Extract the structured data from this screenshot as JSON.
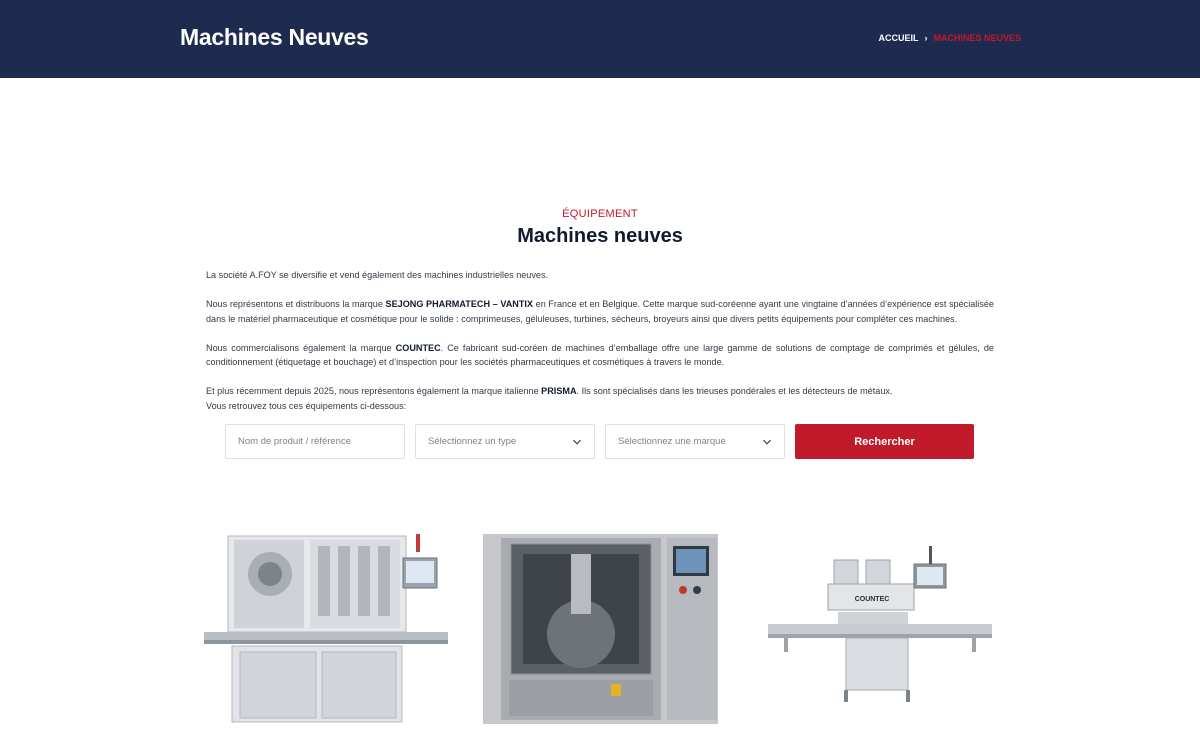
{
  "header": {
    "title": "Machines Neuves",
    "breadcrumb": {
      "home": "ACCUEIL",
      "separator": "›",
      "current": "MACHINES NEUVES"
    }
  },
  "intro": {
    "eyebrow": "ÉQUIPEMENT",
    "title": "Machines neuves",
    "p1": "La société A.FOY se diversifie et vend également des machines industrielles neuves.",
    "p2_before": "Nous représentons et distribuons la marque ",
    "p2_brand": "SEJONG PHARMATECH – VANTIX",
    "p2_after": " en France et en Belgique. Cette marque sud-coréenne ayant une vingtaine d’années d’expérience est spécialisée dans le matériel pharmaceutique et cosmétique pour le solide : comprimeuses, géluleuses, turbines, sécheurs, broyeurs ainsi que divers petits équipements pour compléter ces machines.",
    "p3_before": "Nous commercialisons également la marque ",
    "p3_brand": "COUNTEC",
    "p3_after": ". Ce fabricant sud-coréen de machines d’emballage offre une large gamme de solutions de comptage de comprimés et gélules, de conditionnement (étiquetage et bouchage) et d’inspection pour les sociétés pharmaceutiques et cosmétiques à travers le monde.",
    "p4_before": "Et plus récemment depuis 2025, nous représentons également la marque italienne ",
    "p4_brand": "PRISMA",
    "p4_after": ". Ils sont spécialisés dans les trieuses pondérales et les détecteurs de métaux.",
    "p5": "Vous retrouvez tous ces équipements ci-dessous:"
  },
  "search": {
    "product_placeholder": "Nom de produit / référence",
    "type_select": "Sélectionnez un type",
    "brand_select": "Sélectionnez une marque",
    "button_label": "Rechercher"
  },
  "products": [
    {
      "name": "capping-machine",
      "icon": "machine-image"
    },
    {
      "name": "tablet-press",
      "icon": "machine-image"
    },
    {
      "name": "countec-counter",
      "label": "COUNTEC",
      "icon": "machine-image"
    }
  ],
  "colors": {
    "navy": "#1d2b4f",
    "accent_red": "#c11a2b",
    "text": "#333a45"
  }
}
